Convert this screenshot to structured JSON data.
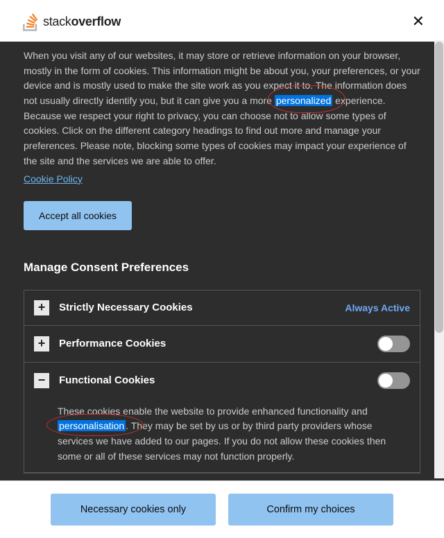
{
  "header": {
    "logo_stack": "stack",
    "logo_overflow": "overflow",
    "close_glyph": "✕"
  },
  "intro": {
    "p1_a": "When you visit any of our websites, it may store or retrieve information on your browser, mostly in the form of cookies. This information might be about you, your preferences, or your device and is mostly used to make the site work as you expect it to. The information does not usually directly identify you, but it can give you a more ",
    "hl1": "personalized",
    "p1_b": " experience. Because we respect your right to privacy, you can choose not to allow some types of cookies. Click on the different category headings to find out more and manage your preferences. Please note, blocking some types of cookies may impact your experience of the site and the services we are able to offer.",
    "cookie_policy": "Cookie Policy",
    "accept_btn": "Accept all cookies"
  },
  "manage": {
    "title": "Manage Consent Preferences",
    "items": [
      {
        "title": "Strictly Necessary Cookies",
        "status": "Always Active",
        "expanded": false
      },
      {
        "title": "Performance Cookies",
        "toggle": false,
        "expanded": false
      },
      {
        "title": "Functional Cookies",
        "toggle": false,
        "expanded": true,
        "content_a": "These cookies enable the website to provide enhanced functionality and ",
        "hl2": "personalisation",
        "content_b": ". They may be set by us or by third party providers whose services we have added to our pages. If you do not allow these cookies then some or all of these services may not function properly."
      }
    ]
  },
  "footer": {
    "necessary": "Necessary cookies only",
    "confirm": "Confirm my choices"
  }
}
